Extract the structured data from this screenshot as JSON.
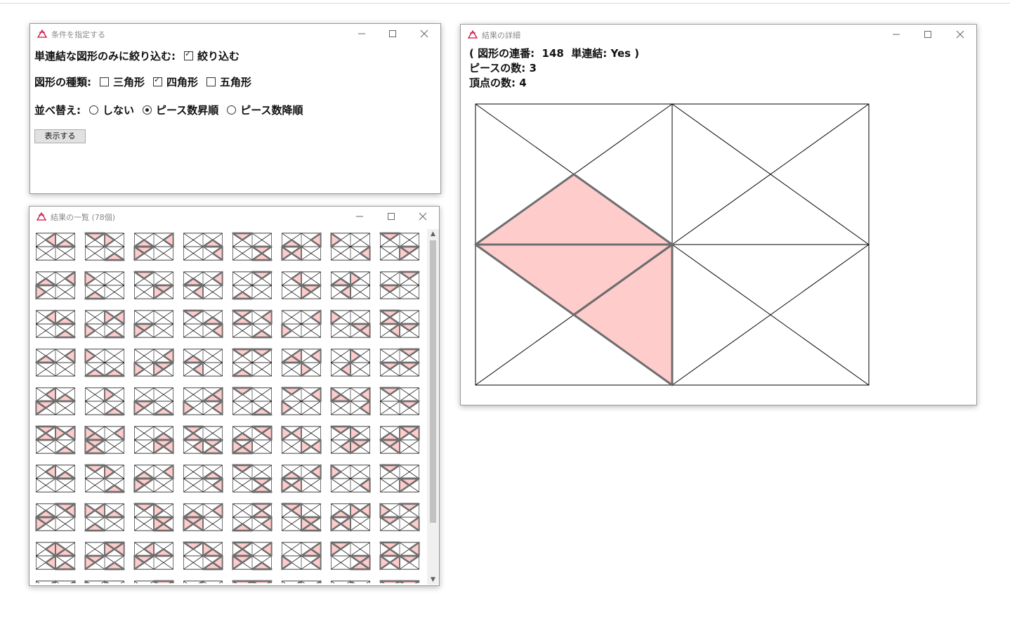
{
  "conditions_window": {
    "title": "条件を指定する",
    "filter_label": "単連結な図形のみに絞り込む:",
    "filter_option": "絞り込む",
    "shape_type_label": "図形の種類:",
    "shape_options": [
      "三角形",
      "四角形",
      "五角形"
    ],
    "sort_label": "並べ替え:",
    "sort_options": [
      "しない",
      "ピース数昇順",
      "ピース数降順"
    ],
    "show_button": "表示する"
  },
  "list_window": {
    "title": "結果の一覧 (78個)"
  },
  "detail_window": {
    "title": "結果の詳細",
    "line1": "( 図形の連番:  148  単連結: Yes )",
    "line2": "ピースの数: 3",
    "line3": "頂点の数: 4"
  },
  "colors": {
    "fill": "#ffcccc",
    "stroke": "#6e6e6e",
    "line": "#000000"
  }
}
